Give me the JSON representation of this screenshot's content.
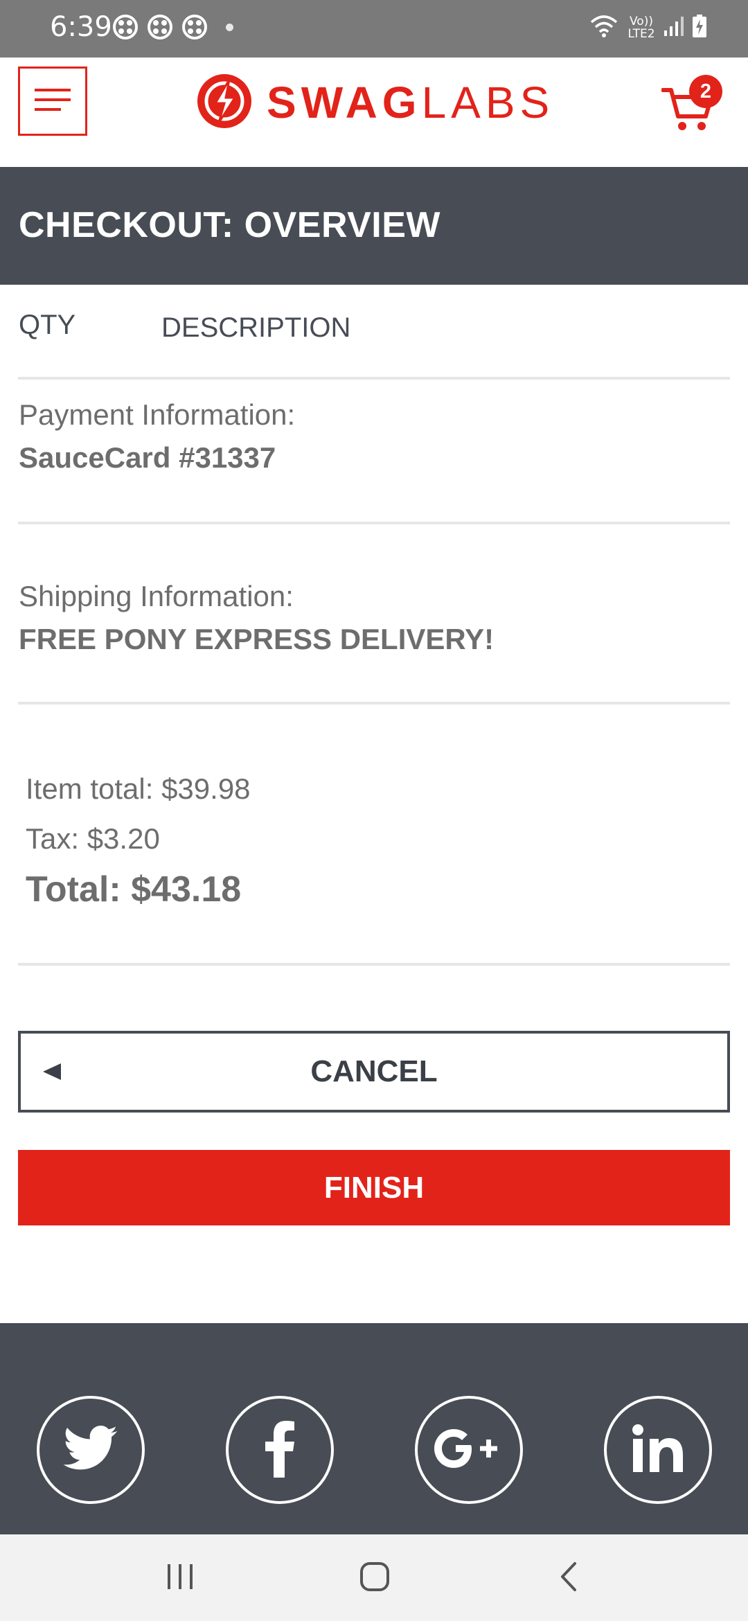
{
  "status_bar": {
    "time": "6:39",
    "network_label": "Vo)) LTE2",
    "icons": [
      "notification-icon",
      "notification-icon",
      "notification-icon",
      "dot-icon",
      "wifi-icon",
      "signal-icon",
      "battery-charging-icon"
    ]
  },
  "header": {
    "brand_bold": "SWAG",
    "brand_light": "LABS",
    "cart_count": "2",
    "icons": [
      "hamburger-menu-icon",
      "swaglabs-logo-icon",
      "cart-icon"
    ]
  },
  "page": {
    "title": "CHECKOUT: OVERVIEW"
  },
  "cart_list": {
    "qty_label": "QTY",
    "description_label": "DESCRIPTION"
  },
  "payment": {
    "label": "Payment Information:",
    "value": "SauceCard #31337"
  },
  "shipping": {
    "label": "Shipping Information:",
    "value": "FREE PONY EXPRESS DELIVERY!"
  },
  "summary": {
    "item_total": "Item total: $39.98",
    "tax": "Tax: $3.20",
    "total": "Total: $43.18"
  },
  "actions": {
    "cancel_label": "CANCEL",
    "finish_label": "FINISH"
  },
  "footer": {
    "social": [
      "twitter-icon",
      "facebook-icon",
      "google-plus-icon",
      "linkedin-icon"
    ]
  },
  "nav_bar": {
    "icons": [
      "recent-apps-icon",
      "home-icon",
      "back-icon"
    ]
  },
  "colors": {
    "brand_red": "#e2231a",
    "dark_slate": "#474c55",
    "text_gray": "#6d6d6d",
    "divider": "#e6e6e6"
  }
}
